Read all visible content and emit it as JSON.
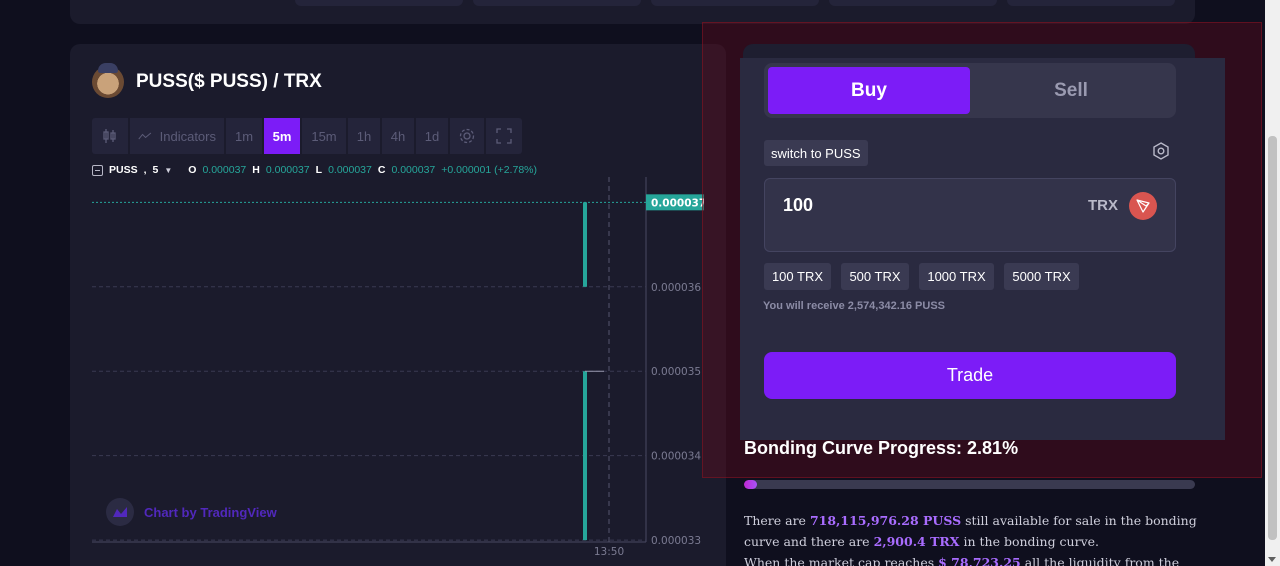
{
  "pair": {
    "title": "PUSS($ PUSS) / TRX",
    "avatar_icon": "cat-avatar-icon"
  },
  "toolbar": {
    "candles_icon": "candlestick-icon",
    "indicators_label": "Indicators",
    "intervals": [
      "1m",
      "5m",
      "15m",
      "1h",
      "4h",
      "1d"
    ],
    "active_interval": "5m",
    "settings_icon": "gear-icon",
    "fullscreen_icon": "fullscreen-icon"
  },
  "ohlc": {
    "symbol": "PUSS",
    "interval": "5",
    "open_label": "O",
    "open": "0.000037",
    "high_label": "H",
    "high": "0.000037",
    "low_label": "L",
    "low": "0.000037",
    "close_label": "C",
    "close": "0.000037",
    "change": "+0.000001 (+2.78%)"
  },
  "chart_data": {
    "type": "candlestick",
    "y_ticks": [
      "0.000036",
      "0.000035",
      "0.000034",
      "0.000033"
    ],
    "x_ticks": [
      "13:50"
    ],
    "last_price_label": "0.000037",
    "ylim": [
      3.28e-05,
      3.73e-05
    ],
    "candles": [
      {
        "open": 3.3e-05,
        "high": 3.5e-05,
        "low": 3.3e-05,
        "close": 3.5e-05
      },
      {
        "open": 3.6e-05,
        "high": 3.7e-05,
        "low": 3.6e-05,
        "close": 3.7e-05
      }
    ],
    "colors": {
      "up": "#26a69a",
      "grid": "#3a3a52",
      "price_line": "#26a69a"
    }
  },
  "watermark": {
    "text": "Chart by TradingView"
  },
  "trade": {
    "buy_label": "Buy",
    "sell_label": "Sell",
    "switch_label": "switch to PUSS",
    "amount_value": "100",
    "amount_currency": "TRX",
    "presets": [
      "100 TRX",
      "500 TRX",
      "1000 TRX",
      "5000 TRX"
    ],
    "receive_text": "You will receive 2,574,342.16 PUSS",
    "trade_label": "Trade"
  },
  "bonding": {
    "title": "Bonding Curve Progress: 2.81%",
    "progress_percent": 2.81,
    "line1_a": "There are ",
    "line1_hl": "718,115,976.28 PUSS",
    "line1_b": " still available for sale in the bonding curve and there are ",
    "line2_hl": "2,900.4 TRX",
    "line2_b": " in the bonding curve.",
    "line3_a": "When the market cap reaches ",
    "line3_hl": "$ 78,723.25",
    "line3_b": " all the liquidity from the bonding curve"
  },
  "colors": {
    "accent": "#7c1cf7",
    "card": "#1b1b2c",
    "background": "#0f0f1e",
    "overlay": "#6e0a19"
  }
}
